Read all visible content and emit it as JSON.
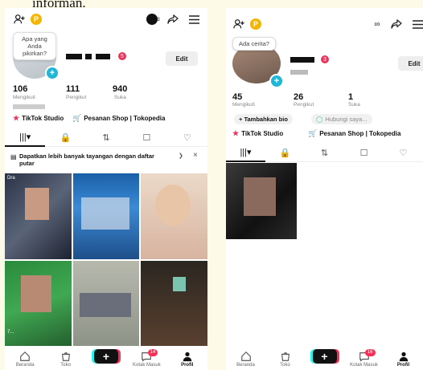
{
  "caption": "informan.",
  "left": {
    "coin": "P",
    "bubble": "Apa yang Anda pikirkan?",
    "badge": "5",
    "edit": "Edit",
    "stats": [
      {
        "num": "106",
        "label": "Mengikuti"
      },
      {
        "num": "111",
        "label": "Pengikut"
      },
      {
        "num": "940",
        "label": "Suka"
      }
    ],
    "links": [
      "TikTok Studio",
      "Pesanan Shop | Tokopedia"
    ],
    "toggle_count": "33",
    "promo_text": "Dapatkan lebih banyak tayangan dengan daftar putar",
    "promo_close": "×",
    "thumb_label": "Dra",
    "thumb_views": "7...",
    "nav": [
      {
        "label": "Beranda"
      },
      {
        "label": "Toko"
      },
      {
        "label": "+"
      },
      {
        "label": "Kotak Masuk",
        "badge": "14"
      },
      {
        "label": "Profil"
      }
    ]
  },
  "right": {
    "coin": "P",
    "bubble": "Ada cerita?",
    "badge": "3",
    "edit": "Edit",
    "stats": [
      {
        "num": "45",
        "label": "Mengikuti"
      },
      {
        "num": "26",
        "label": "Pengikut"
      },
      {
        "num": "1",
        "label": "Suka"
      }
    ],
    "bio_btn": "+ Tambahkan bio",
    "contact_btn": "Hubungi saya...",
    "links": [
      "TikTok Studio",
      "Pesanan Shop | Tokopedia"
    ],
    "nav": [
      {
        "label": "Beranda"
      },
      {
        "label": "Toko"
      },
      {
        "label": "+"
      },
      {
        "label": "Kotak Masuk",
        "badge": "16"
      },
      {
        "label": "Profil"
      }
    ]
  }
}
